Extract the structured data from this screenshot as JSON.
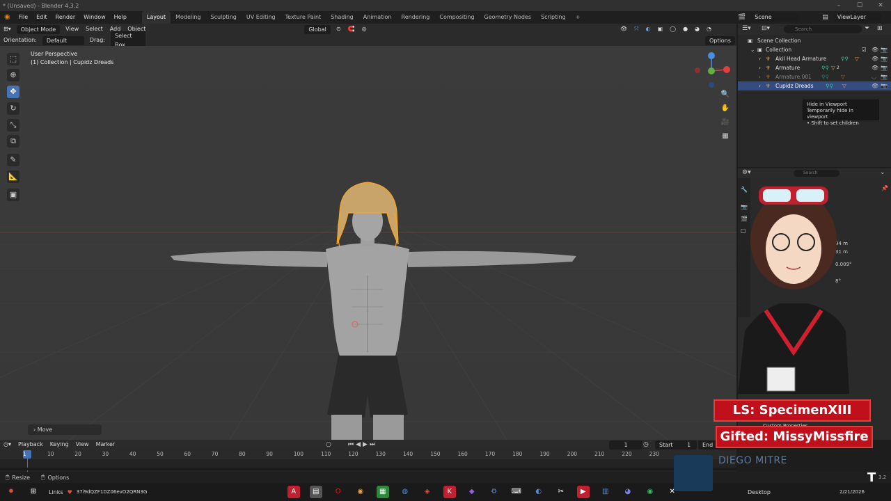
{
  "window": {
    "title": "* (Unsaved) - Blender 4.3.2"
  },
  "menu": [
    "File",
    "Edit",
    "Render",
    "Window",
    "Help"
  ],
  "workspaces": [
    "Layout",
    "Modeling",
    "Sculpting",
    "UV Editing",
    "Texture Paint",
    "Shading",
    "Animation",
    "Rendering",
    "Compositing",
    "Geometry Nodes",
    "Scripting"
  ],
  "scene": {
    "label": "Scene",
    "view_layer": "ViewLayer"
  },
  "viewport_header": {
    "mode": "Object Mode",
    "items": [
      "View",
      "Select",
      "Add",
      "Object"
    ],
    "transform": "Global",
    "orientation_label": "Orientation:",
    "orientation_value": "Default",
    "drag_label": "Drag:",
    "drag_value": "Select Box",
    "options": "Options"
  },
  "viewport": {
    "perspective": "User Perspective",
    "collection_info": "(1) Collection | Cupidz Dreads",
    "last_op": "Move"
  },
  "outliner": {
    "search_placeholder": "Search",
    "rows": [
      {
        "label": "Scene Collection"
      },
      {
        "label": "Collection"
      },
      {
        "label": "Akil Head Armature"
      },
      {
        "label": "Armature",
        "badge": "2"
      },
      {
        "label": "Armature.001"
      },
      {
        "label": "Cupidz Dreads"
      }
    ],
    "tooltip": {
      "title": "Hide in Viewport",
      "line1": "Temporarily hide in viewport",
      "line2": "• Shift to set children"
    }
  },
  "properties": {
    "search_placeholder": "Search",
    "custom_props": "Custom Properties",
    "values": [
      "94 m",
      "31 m",
      "0.009°",
      "8°"
    ]
  },
  "timeline": {
    "menus": [
      "Playback",
      "Keying",
      "View",
      "Marker"
    ],
    "current_frame": "1",
    "start_label": "Start",
    "start_value": "1",
    "end_label": "End",
    "ticks": [
      "1",
      "10",
      "20",
      "30",
      "40",
      "50",
      "60",
      "70",
      "80",
      "90",
      "100",
      "110",
      "120",
      "130",
      "140",
      "150",
      "160",
      "170",
      "180",
      "190",
      "200",
      "210",
      "220",
      "230"
    ]
  },
  "statusbar": {
    "left": "Resize",
    "right": "Options",
    "version": "3.2"
  },
  "overlays": {
    "ls_banner": "LS: SpecimenXIII",
    "gifted_banner": "Gifted: MissyMissfire",
    "watermark": "DIEGO MITRE",
    "logo_letter": "T"
  },
  "taskbar": {
    "links_label": "Links",
    "tab_text": "37i9dQZF1DZ06evO2QRN3G",
    "desktop_label": "Desktop",
    "date": "2/21/2026"
  },
  "colors": {
    "accent": "#4772b3",
    "selection": "#334d80",
    "banner": "#c0101c",
    "orange_select": "#f5a623"
  }
}
